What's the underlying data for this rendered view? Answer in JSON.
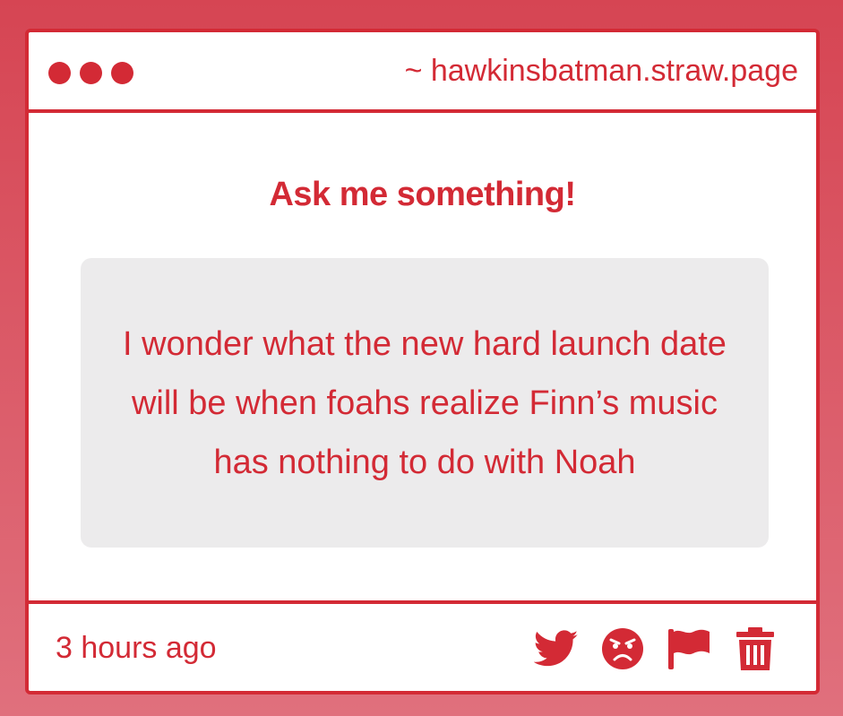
{
  "window": {
    "url": "~ hawkinsbatman.straw.page"
  },
  "main": {
    "heading": "Ask me something!",
    "question": "I wonder what the new hard launch date will be when foahs realize Finn’s music has nothing to do with Noah"
  },
  "footer": {
    "timestamp": "3 hours ago",
    "actions": [
      {
        "name": "twitter-share",
        "icon": "twitter-bird-icon"
      },
      {
        "name": "angry-reaction",
        "icon": "angry-face-icon"
      },
      {
        "name": "report",
        "icon": "flag-icon"
      },
      {
        "name": "delete",
        "icon": "trash-icon"
      }
    ]
  },
  "colors": {
    "accent": "#d32a35",
    "question_bg": "#ecebec",
    "background_top": "#d64553",
    "background_bottom": "#e0707d"
  }
}
